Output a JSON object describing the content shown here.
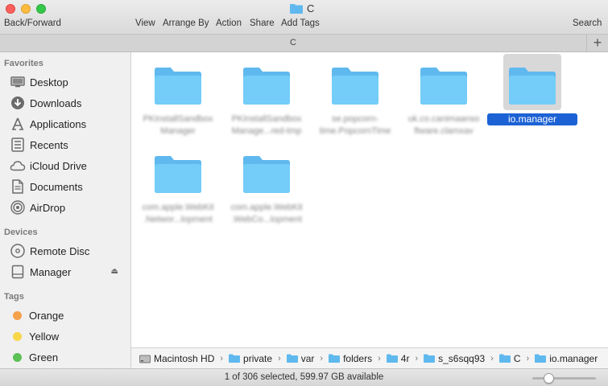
{
  "window": {
    "title": "C",
    "controls": [
      "close",
      "minimize",
      "maximize"
    ]
  },
  "toolbar": {
    "back_forward": "Back/Forward",
    "view": "View",
    "arrange_by": "Arrange By",
    "action": "Action",
    "share": "Share",
    "add_tags": "Add Tags",
    "search": "Search"
  },
  "tabbar": {
    "title": "C",
    "add": "+"
  },
  "sidebar": {
    "favorites_header": "Favorites",
    "favorites": [
      {
        "label": "Desktop",
        "icon": "desktop-icon"
      },
      {
        "label": "Downloads",
        "icon": "downloads-icon"
      },
      {
        "label": "Applications",
        "icon": "applications-icon"
      },
      {
        "label": "Recents",
        "icon": "recents-icon"
      },
      {
        "label": "iCloud Drive",
        "icon": "cloud-icon"
      },
      {
        "label": "Documents",
        "icon": "documents-icon"
      },
      {
        "label": "AirDrop",
        "icon": "airdrop-icon"
      }
    ],
    "devices_header": "Devices",
    "devices": [
      {
        "label": "Remote Disc",
        "icon": "disc-icon"
      },
      {
        "label": "Manager",
        "icon": "drive-icon",
        "eject": "⏏"
      }
    ],
    "tags_header": "Tags",
    "tags": [
      {
        "label": "Orange",
        "color": "#f5a04a"
      },
      {
        "label": "Yellow",
        "color": "#f7d64a"
      },
      {
        "label": "Green",
        "color": "#5cc155"
      }
    ]
  },
  "files": [
    {
      "line1": "PKInstallSandbox",
      "line2": "Manager",
      "selected": false
    },
    {
      "line1": "PKInstallSandbox",
      "line2": "Manage...red-tmp",
      "selected": false
    },
    {
      "line1": "se.popcorn-",
      "line2": "time.PopcornTime",
      "selected": false
    },
    {
      "line1": "uk.co.canimaanso",
      "line2": "ftware.clamxav",
      "selected": false
    },
    {
      "line1": "io.manager",
      "line2": "",
      "selected": true
    },
    {
      "line1": "com.apple.WebKit",
      "line2": ".Networ...lopment",
      "selected": false
    },
    {
      "line1": "com.apple.WebKit",
      "line2": ".WebCo...lopment",
      "selected": false
    }
  ],
  "pathbar": [
    {
      "label": "Macintosh HD",
      "icon": "hard-drive-icon"
    },
    {
      "label": "private",
      "icon": "folder-icon"
    },
    {
      "label": "var",
      "icon": "folder-icon"
    },
    {
      "label": "folders",
      "icon": "folder-icon"
    },
    {
      "label": "4r",
      "icon": "folder-icon"
    },
    {
      "label": "s_s6sqq93",
      "icon": "folder-icon"
    },
    {
      "label": "C",
      "icon": "folder-icon"
    },
    {
      "label": "io.manager",
      "icon": "folder-icon"
    }
  ],
  "status": {
    "text": "1 of 306 selected, 599.97 GB available",
    "zoom_level": 0.25
  },
  "colors": {
    "selection": "#1c62d4",
    "folder": "#6cc6f5"
  }
}
